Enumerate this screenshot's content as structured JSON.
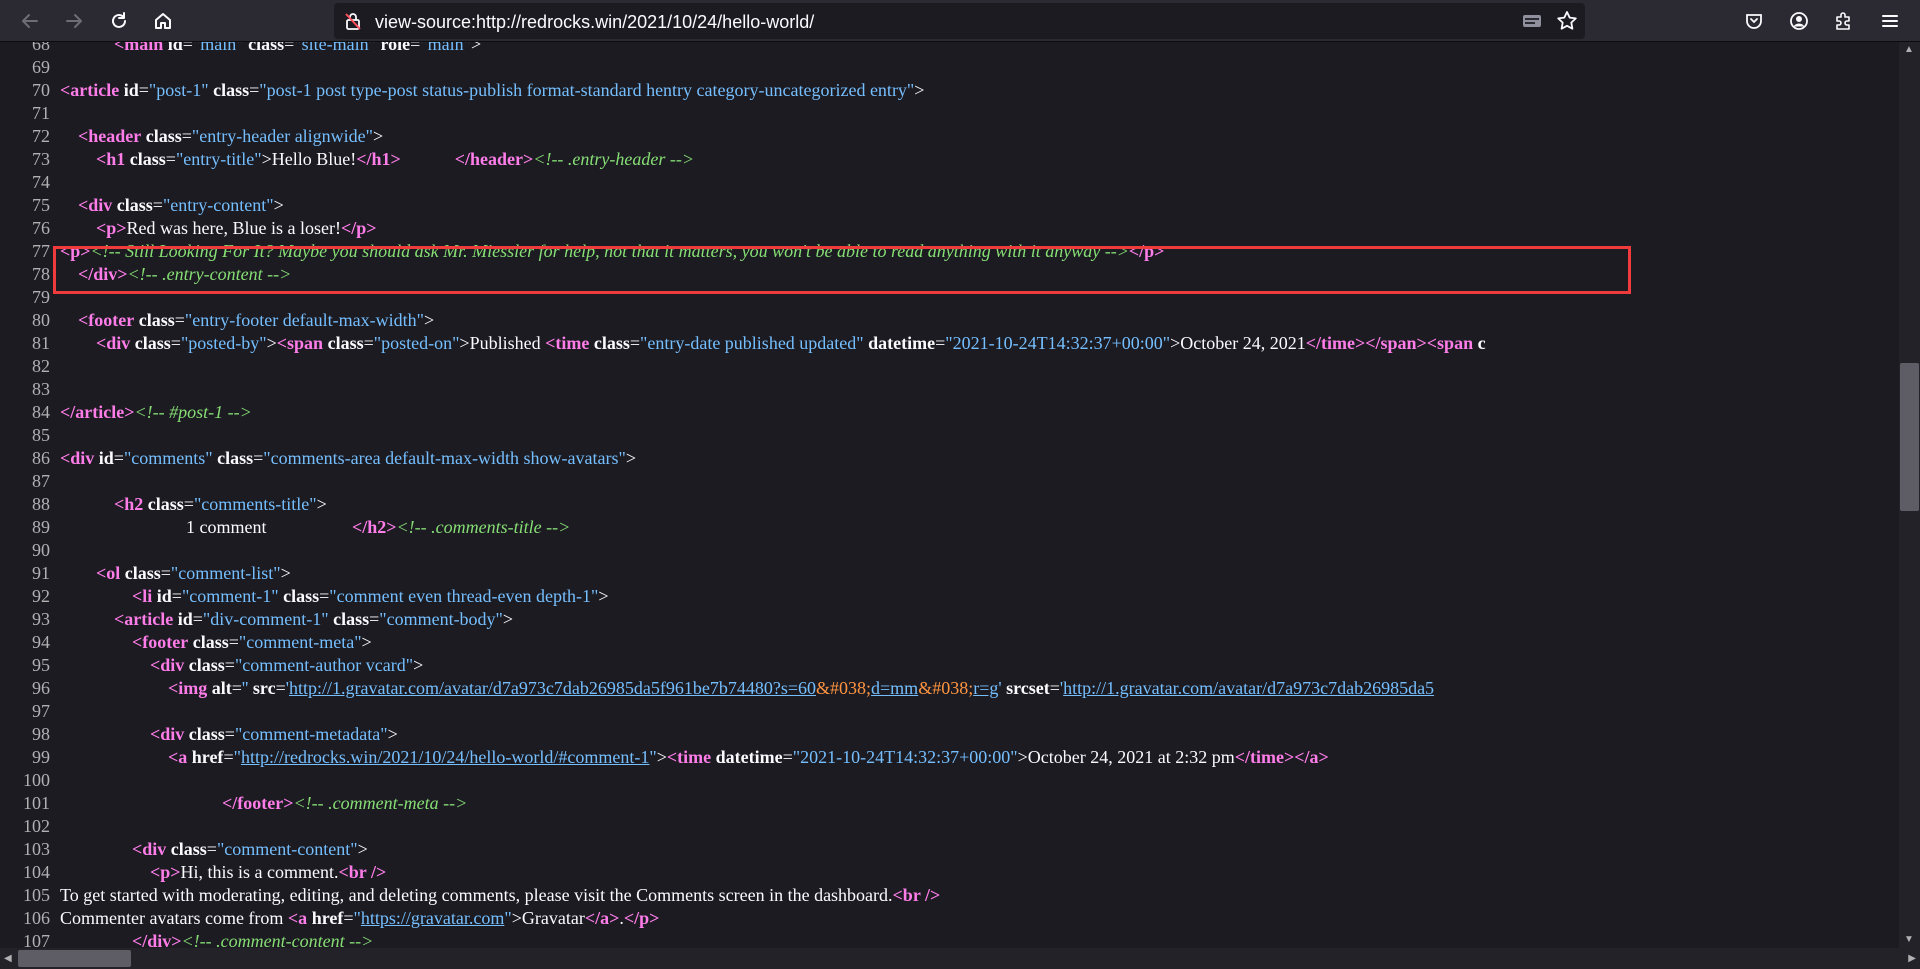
{
  "browser": {
    "url": "view-source:http://redrocks.win/2021/10/24/hello-world/",
    "icons": {
      "back": "arrow-left-icon",
      "forward": "arrow-right-icon",
      "reload": "reload-icon",
      "home": "home-icon",
      "page_info": "insecure-lock-icon",
      "reader": "reader-view-icon",
      "bookmark": "star-icon",
      "pocket": "pocket-icon",
      "account": "account-icon",
      "extensions": "puzzle-icon",
      "menu": "hamburger-menu-icon"
    }
  },
  "source_lines": [
    {
      "n": "68",
      "tokens": [
        {
          "k": "p",
          "v": "            "
        },
        {
          "k": "t",
          "v": "<main"
        },
        {
          "k": "p",
          "v": " "
        },
        {
          "k": "a",
          "v": "id"
        },
        {
          "k": "p",
          "v": "="
        },
        {
          "k": "v",
          "v": "\"main\""
        },
        {
          "k": "p",
          "v": " "
        },
        {
          "k": "a",
          "v": "class"
        },
        {
          "k": "p",
          "v": "="
        },
        {
          "k": "v",
          "v": "\"site-main\""
        },
        {
          "k": "p",
          "v": " "
        },
        {
          "k": "a",
          "v": "role"
        },
        {
          "k": "p",
          "v": "="
        },
        {
          "k": "v",
          "v": "\"main\""
        },
        {
          "k": "p",
          "v": ">"
        }
      ]
    },
    {
      "n": "69",
      "tokens": []
    },
    {
      "n": "70",
      "tokens": [
        {
          "k": "t",
          "v": "<article"
        },
        {
          "k": "p",
          "v": " "
        },
        {
          "k": "a",
          "v": "id"
        },
        {
          "k": "p",
          "v": "="
        },
        {
          "k": "v",
          "v": "\"post-1\""
        },
        {
          "k": "p",
          "v": " "
        },
        {
          "k": "a",
          "v": "class"
        },
        {
          "k": "p",
          "v": "="
        },
        {
          "k": "v",
          "v": "\"post-1 post type-post status-publish format-standard hentry category-uncategorized entry\""
        },
        {
          "k": "p",
          "v": ">"
        }
      ]
    },
    {
      "n": "71",
      "tokens": []
    },
    {
      "n": "72",
      "tokens": [
        {
          "k": "p",
          "v": "    "
        },
        {
          "k": "t",
          "v": "<header"
        },
        {
          "k": "p",
          "v": " "
        },
        {
          "k": "a",
          "v": "class"
        },
        {
          "k": "p",
          "v": "="
        },
        {
          "k": "v",
          "v": "\"entry-header alignwide\""
        },
        {
          "k": "p",
          "v": ">"
        }
      ]
    },
    {
      "n": "73",
      "tokens": [
        {
          "k": "p",
          "v": "        "
        },
        {
          "k": "t",
          "v": "<h1"
        },
        {
          "k": "p",
          "v": " "
        },
        {
          "k": "a",
          "v": "class"
        },
        {
          "k": "p",
          "v": "="
        },
        {
          "k": "v",
          "v": "\"entry-title\""
        },
        {
          "k": "p",
          "v": ">Hello Blue!"
        },
        {
          "k": "t",
          "v": "</h1>"
        },
        {
          "k": "p",
          "v": "            "
        },
        {
          "k": "t",
          "v": "</header>"
        },
        {
          "k": "c",
          "v": "<!-- .entry-header -->"
        }
      ]
    },
    {
      "n": "74",
      "tokens": []
    },
    {
      "n": "75",
      "tokens": [
        {
          "k": "p",
          "v": "    "
        },
        {
          "k": "t",
          "v": "<div"
        },
        {
          "k": "p",
          "v": " "
        },
        {
          "k": "a",
          "v": "class"
        },
        {
          "k": "p",
          "v": "="
        },
        {
          "k": "v",
          "v": "\"entry-content\""
        },
        {
          "k": "p",
          "v": ">"
        }
      ]
    },
    {
      "n": "76",
      "tokens": [
        {
          "k": "p",
          "v": "        "
        },
        {
          "k": "t",
          "v": "<p>"
        },
        {
          "k": "p",
          "v": "Red was here, Blue is a loser!"
        },
        {
          "k": "t",
          "v": "</p>"
        }
      ]
    },
    {
      "n": "77",
      "tokens": [
        {
          "k": "t",
          "v": "<p>"
        },
        {
          "k": "c",
          "v": "<!-- Still Looking For It? Maybe you should ask Mr. Miessler for help, not that it matters, you won't be able to read anything with it anyway -->"
        },
        {
          "k": "t",
          "v": "</p>"
        }
      ]
    },
    {
      "n": "78",
      "tokens": [
        {
          "k": "p",
          "v": "    "
        },
        {
          "k": "t",
          "v": "</div>"
        },
        {
          "k": "c",
          "v": "<!-- .entry-content -->"
        }
      ]
    },
    {
      "n": "79",
      "tokens": []
    },
    {
      "n": "80",
      "tokens": [
        {
          "k": "p",
          "v": "    "
        },
        {
          "k": "t",
          "v": "<footer"
        },
        {
          "k": "p",
          "v": " "
        },
        {
          "k": "a",
          "v": "class"
        },
        {
          "k": "p",
          "v": "="
        },
        {
          "k": "v",
          "v": "\"entry-footer default-max-width\""
        },
        {
          "k": "p",
          "v": ">"
        }
      ]
    },
    {
      "n": "81",
      "tokens": [
        {
          "k": "p",
          "v": "        "
        },
        {
          "k": "t",
          "v": "<div"
        },
        {
          "k": "p",
          "v": " "
        },
        {
          "k": "a",
          "v": "class"
        },
        {
          "k": "p",
          "v": "="
        },
        {
          "k": "v",
          "v": "\"posted-by\""
        },
        {
          "k": "p",
          "v": ">"
        },
        {
          "k": "t",
          "v": "<span"
        },
        {
          "k": "p",
          "v": " "
        },
        {
          "k": "a",
          "v": "class"
        },
        {
          "k": "p",
          "v": "="
        },
        {
          "k": "v",
          "v": "\"posted-on\""
        },
        {
          "k": "p",
          "v": ">Published "
        },
        {
          "k": "t",
          "v": "<time"
        },
        {
          "k": "p",
          "v": " "
        },
        {
          "k": "a",
          "v": "class"
        },
        {
          "k": "p",
          "v": "="
        },
        {
          "k": "v",
          "v": "\"entry-date published updated\""
        },
        {
          "k": "p",
          "v": " "
        },
        {
          "k": "a",
          "v": "datetime"
        },
        {
          "k": "p",
          "v": "="
        },
        {
          "k": "v",
          "v": "\"2021-10-24T14:32:37+00:00\""
        },
        {
          "k": "p",
          "v": ">October 24, 2021"
        },
        {
          "k": "t",
          "v": "</time>"
        },
        {
          "k": "t",
          "v": "</span>"
        },
        {
          "k": "t",
          "v": "<span"
        },
        {
          "k": "p",
          "v": " "
        },
        {
          "k": "a",
          "v": "c"
        }
      ]
    },
    {
      "n": "82",
      "tokens": []
    },
    {
      "n": "83",
      "tokens": []
    },
    {
      "n": "84",
      "tokens": [
        {
          "k": "t",
          "v": "</article>"
        },
        {
          "k": "c",
          "v": "<!-- #post-1 -->"
        }
      ]
    },
    {
      "n": "85",
      "tokens": []
    },
    {
      "n": "86",
      "tokens": [
        {
          "k": "t",
          "v": "<div"
        },
        {
          "k": "p",
          "v": " "
        },
        {
          "k": "a",
          "v": "id"
        },
        {
          "k": "p",
          "v": "="
        },
        {
          "k": "v",
          "v": "\"comments\""
        },
        {
          "k": "p",
          "v": " "
        },
        {
          "k": "a",
          "v": "class"
        },
        {
          "k": "p",
          "v": "="
        },
        {
          "k": "v",
          "v": "\"comments-area default-max-width show-avatars\""
        },
        {
          "k": "p",
          "v": ">"
        }
      ]
    },
    {
      "n": "87",
      "tokens": []
    },
    {
      "n": "88",
      "tokens": [
        {
          "k": "p",
          "v": "            "
        },
        {
          "k": "t",
          "v": "<h2"
        },
        {
          "k": "p",
          "v": " "
        },
        {
          "k": "a",
          "v": "class"
        },
        {
          "k": "p",
          "v": "="
        },
        {
          "k": "v",
          "v": "\"comments-title\""
        },
        {
          "k": "p",
          "v": ">"
        }
      ]
    },
    {
      "n": "89",
      "tokens": [
        {
          "k": "p",
          "v": "                            1 comment                   "
        },
        {
          "k": "t",
          "v": "</h2>"
        },
        {
          "k": "c",
          "v": "<!-- .comments-title -->"
        }
      ]
    },
    {
      "n": "90",
      "tokens": []
    },
    {
      "n": "91",
      "tokens": [
        {
          "k": "p",
          "v": "        "
        },
        {
          "k": "t",
          "v": "<ol"
        },
        {
          "k": "p",
          "v": " "
        },
        {
          "k": "a",
          "v": "class"
        },
        {
          "k": "p",
          "v": "="
        },
        {
          "k": "v",
          "v": "\"comment-list\""
        },
        {
          "k": "p",
          "v": ">"
        }
      ]
    },
    {
      "n": "92",
      "tokens": [
        {
          "k": "p",
          "v": "                "
        },
        {
          "k": "t",
          "v": "<li"
        },
        {
          "k": "p",
          "v": " "
        },
        {
          "k": "a",
          "v": "id"
        },
        {
          "k": "p",
          "v": "="
        },
        {
          "k": "v",
          "v": "\"comment-1\""
        },
        {
          "k": "p",
          "v": " "
        },
        {
          "k": "a",
          "v": "class"
        },
        {
          "k": "p",
          "v": "="
        },
        {
          "k": "v",
          "v": "\"comment even thread-even depth-1\""
        },
        {
          "k": "p",
          "v": ">"
        }
      ]
    },
    {
      "n": "93",
      "tokens": [
        {
          "k": "p",
          "v": "            "
        },
        {
          "k": "t",
          "v": "<article"
        },
        {
          "k": "p",
          "v": " "
        },
        {
          "k": "a",
          "v": "id"
        },
        {
          "k": "p",
          "v": "="
        },
        {
          "k": "v",
          "v": "\"div-comment-1\""
        },
        {
          "k": "p",
          "v": " "
        },
        {
          "k": "a",
          "v": "class"
        },
        {
          "k": "p",
          "v": "="
        },
        {
          "k": "v",
          "v": "\"comment-body\""
        },
        {
          "k": "p",
          "v": ">"
        }
      ]
    },
    {
      "n": "94",
      "tokens": [
        {
          "k": "p",
          "v": "                "
        },
        {
          "k": "t",
          "v": "<footer"
        },
        {
          "k": "p",
          "v": " "
        },
        {
          "k": "a",
          "v": "class"
        },
        {
          "k": "p",
          "v": "="
        },
        {
          "k": "v",
          "v": "\"comment-meta\""
        },
        {
          "k": "p",
          "v": ">"
        }
      ]
    },
    {
      "n": "95",
      "tokens": [
        {
          "k": "p",
          "v": "                    "
        },
        {
          "k": "t",
          "v": "<div"
        },
        {
          "k": "p",
          "v": " "
        },
        {
          "k": "a",
          "v": "class"
        },
        {
          "k": "p",
          "v": "="
        },
        {
          "k": "v",
          "v": "\"comment-author vcard\""
        },
        {
          "k": "p",
          "v": ">"
        }
      ]
    },
    {
      "n": "96",
      "tokens": [
        {
          "k": "p",
          "v": "                        "
        },
        {
          "k": "t",
          "v": "<img"
        },
        {
          "k": "p",
          "v": " "
        },
        {
          "k": "a",
          "v": "alt"
        },
        {
          "k": "p",
          "v": "="
        },
        {
          "k": "v",
          "v": "''"
        },
        {
          "k": "p",
          "v": " "
        },
        {
          "k": "a",
          "v": "src"
        },
        {
          "k": "p",
          "v": "="
        },
        {
          "k": "v",
          "v": "'"
        },
        {
          "k": "lk",
          "v": "http://1.gravatar.com/avatar/d7a973c7dab26985da5f961be7b74480?s=60"
        },
        {
          "k": "e",
          "v": "&#038;"
        },
        {
          "k": "lk",
          "v": "d=mm"
        },
        {
          "k": "e",
          "v": "&#038;"
        },
        {
          "k": "lk",
          "v": "r=g"
        },
        {
          "k": "v",
          "v": "'"
        },
        {
          "k": "p",
          "v": " "
        },
        {
          "k": "a",
          "v": "srcset"
        },
        {
          "k": "p",
          "v": "="
        },
        {
          "k": "v",
          "v": "'"
        },
        {
          "k": "lk",
          "v": "http://1.gravatar.com/avatar/d7a973c7dab26985da5"
        }
      ]
    },
    {
      "n": "97",
      "tokens": []
    },
    {
      "n": "98",
      "tokens": [
        {
          "k": "p",
          "v": "                    "
        },
        {
          "k": "t",
          "v": "<div"
        },
        {
          "k": "p",
          "v": " "
        },
        {
          "k": "a",
          "v": "class"
        },
        {
          "k": "p",
          "v": "="
        },
        {
          "k": "v",
          "v": "\"comment-metadata\""
        },
        {
          "k": "p",
          "v": ">"
        }
      ]
    },
    {
      "n": "99",
      "tokens": [
        {
          "k": "p",
          "v": "                        "
        },
        {
          "k": "t",
          "v": "<a"
        },
        {
          "k": "p",
          "v": " "
        },
        {
          "k": "a",
          "v": "href"
        },
        {
          "k": "p",
          "v": "="
        },
        {
          "k": "v",
          "v": "\""
        },
        {
          "k": "lk",
          "v": "http://redrocks.win/2021/10/24/hello-world/#comment-1"
        },
        {
          "k": "v",
          "v": "\""
        },
        {
          "k": "p",
          "v": ">"
        },
        {
          "k": "t",
          "v": "<time"
        },
        {
          "k": "p",
          "v": " "
        },
        {
          "k": "a",
          "v": "datetime"
        },
        {
          "k": "p",
          "v": "="
        },
        {
          "k": "v",
          "v": "\"2021-10-24T14:32:37+00:00\""
        },
        {
          "k": "p",
          "v": ">October 24, 2021 at 2:32 pm"
        },
        {
          "k": "t",
          "v": "</time>"
        },
        {
          "k": "t",
          "v": "</a>"
        }
      ]
    },
    {
      "n": "100",
      "tokens": []
    },
    {
      "n": "101",
      "tokens": [
        {
          "k": "p",
          "v": "                                    "
        },
        {
          "k": "t",
          "v": "</footer>"
        },
        {
          "k": "c",
          "v": "<!-- .comment-meta -->"
        }
      ]
    },
    {
      "n": "102",
      "tokens": []
    },
    {
      "n": "103",
      "tokens": [
        {
          "k": "p",
          "v": "                "
        },
        {
          "k": "t",
          "v": "<div"
        },
        {
          "k": "p",
          "v": " "
        },
        {
          "k": "a",
          "v": "class"
        },
        {
          "k": "p",
          "v": "="
        },
        {
          "k": "v",
          "v": "\"comment-content\""
        },
        {
          "k": "p",
          "v": ">"
        }
      ]
    },
    {
      "n": "104",
      "tokens": [
        {
          "k": "p",
          "v": "                    "
        },
        {
          "k": "t",
          "v": "<p>"
        },
        {
          "k": "p",
          "v": "Hi, this is a comment."
        },
        {
          "k": "t",
          "v": "<br />"
        }
      ]
    },
    {
      "n": "105",
      "tokens": [
        {
          "k": "p",
          "v": "To get started with moderating, editing, and deleting comments, please visit the Comments screen in the dashboard."
        },
        {
          "k": "t",
          "v": "<br />"
        }
      ]
    },
    {
      "n": "106",
      "tokens": [
        {
          "k": "p",
          "v": "Commenter avatars come from "
        },
        {
          "k": "t",
          "v": "<a"
        },
        {
          "k": "p",
          "v": " "
        },
        {
          "k": "a",
          "v": "href"
        },
        {
          "k": "p",
          "v": "="
        },
        {
          "k": "v",
          "v": "\""
        },
        {
          "k": "lk",
          "v": "https://gravatar.com"
        },
        {
          "k": "v",
          "v": "\""
        },
        {
          "k": "p",
          "v": ">Gravatar"
        },
        {
          "k": "t",
          "v": "</a>"
        },
        {
          "k": "p",
          "v": "."
        },
        {
          "k": "t",
          "v": "</p>"
        }
      ]
    },
    {
      "n": "107",
      "tokens": [
        {
          "k": "p",
          "v": "                "
        },
        {
          "k": "t",
          "v": "</div>"
        },
        {
          "k": "c",
          "v": "<!-- .comment-content -->"
        }
      ]
    }
  ],
  "scrollbars": {
    "vertical_position": 0.42,
    "vertical_visible_fraction": 0.17,
    "horizontal_position": 0.0,
    "horizontal_visible_fraction": 0.06
  },
  "colors": {
    "tag": "#ff7de9",
    "attribute_value": "#75bfff",
    "comment": "#86de74",
    "entity": "#ff9540",
    "highlight": "#ef3b3b"
  }
}
